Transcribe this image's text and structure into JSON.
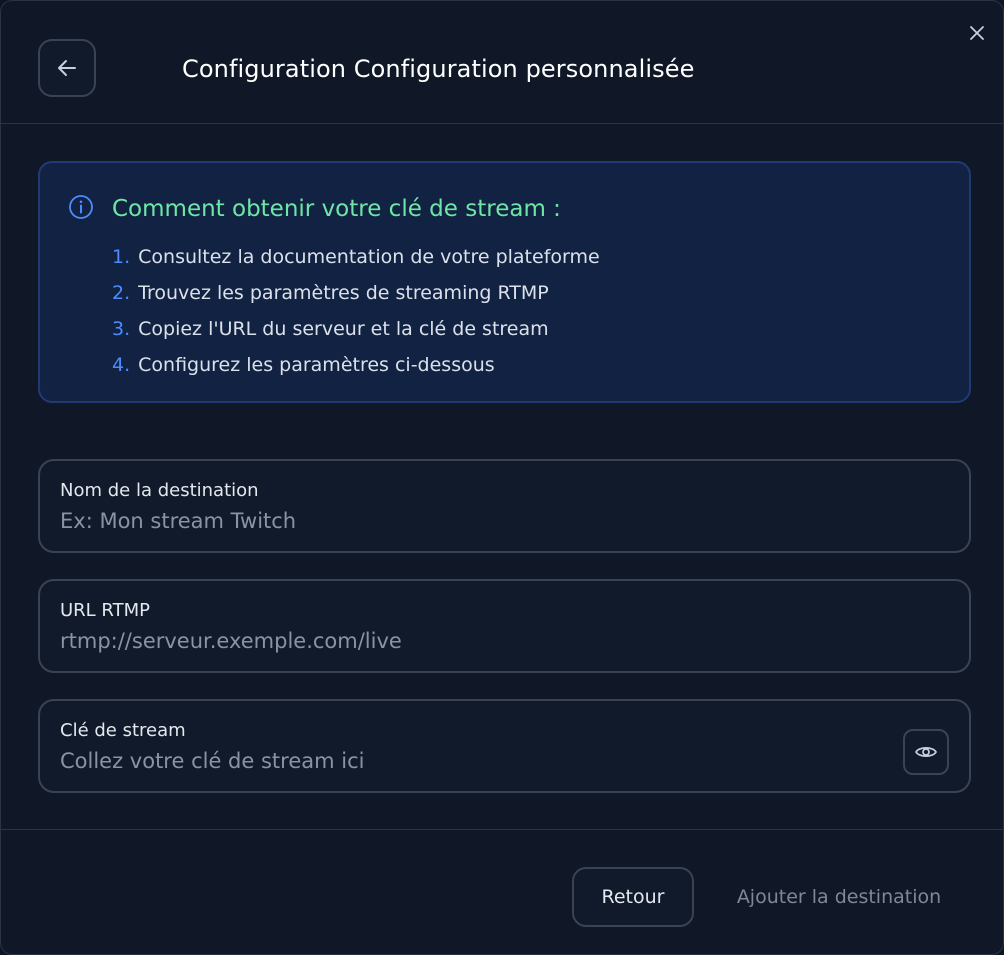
{
  "header": {
    "back_icon": "arrow-left-icon",
    "title": "Configuration Configuration personnalisée",
    "close_icon": "close-icon"
  },
  "info": {
    "icon": "info-circle-icon",
    "title": "Comment obtenir votre clé de stream :",
    "steps": [
      {
        "num": "1.",
        "text": "Consultez la documentation de votre plateforme"
      },
      {
        "num": "2.",
        "text": "Trouvez les paramètres de streaming RTMP"
      },
      {
        "num": "3.",
        "text": "Copiez l'URL du serveur et la clé de stream"
      },
      {
        "num": "4.",
        "text": "Configurez les paramètres ci-dessous"
      }
    ],
    "colors": {
      "title": "#6ee7a6",
      "number": "#4d8cff",
      "border": "#223a74",
      "background": "#122242"
    }
  },
  "form": {
    "name": {
      "label": "Nom de la destination",
      "value": "",
      "placeholder": "Ex: Mon stream Twitch"
    },
    "url": {
      "label": "URL RTMP",
      "value": "",
      "placeholder": "rtmp://serveur.exemple.com/live"
    },
    "key": {
      "label": "Clé de stream",
      "value": "",
      "placeholder": "Collez votre clé de stream ici",
      "toggle_icon": "eye-icon"
    }
  },
  "footer": {
    "back_label": "Retour",
    "submit_label": "Ajouter la destination"
  }
}
